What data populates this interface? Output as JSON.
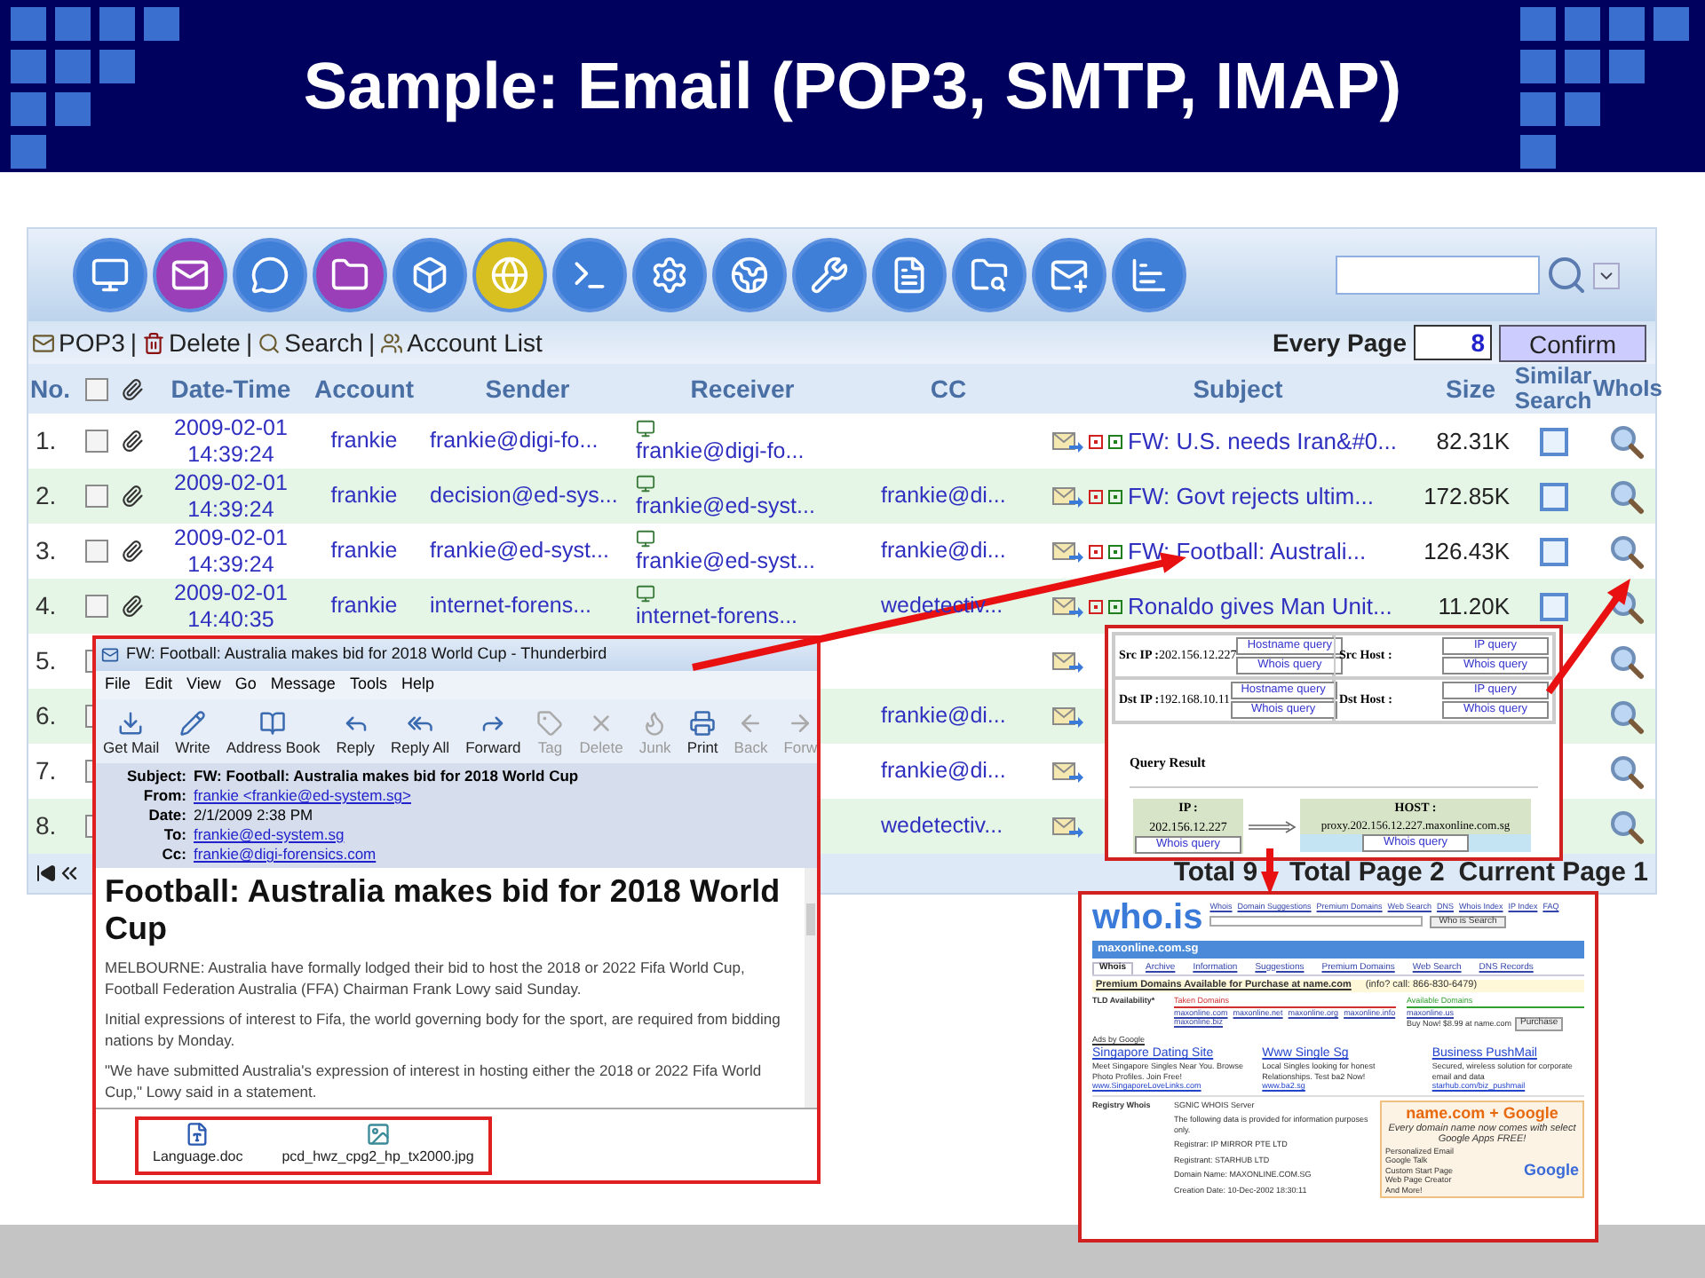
{
  "slide": {
    "title": "Sample: Email (POP3, SMTP, IMAP)"
  },
  "app": {
    "actions": [
      {
        "kind": "link",
        "label": "POP3"
      },
      {
        "kind": "separator",
        "label": "|"
      },
      {
        "kind": "link",
        "label": "Delete"
      },
      {
        "kind": "separator",
        "label": "|"
      },
      {
        "kind": "link",
        "label": "Search"
      },
      {
        "kind": "separator",
        "label": "|"
      },
      {
        "kind": "link",
        "label": "Account List"
      }
    ],
    "every_page": {
      "label": "Every Page",
      "value": "8",
      "button": "Confirm"
    },
    "columns": [
      {
        "kind": "text",
        "label": "No."
      },
      {
        "kind": "checkbox",
        "checked": false
      },
      {
        "kind": "attachment"
      },
      {
        "kind": "text",
        "label": "Date-Time"
      },
      {
        "kind": "text",
        "label": "Account"
      },
      {
        "kind": "text",
        "label": "Sender"
      },
      {
        "kind": "text",
        "label": "Receiver"
      },
      {
        "kind": "text",
        "label": "CC"
      },
      {
        "kind": "text",
        "label": "Subject"
      },
      {
        "kind": "text",
        "label": "Size"
      },
      {
        "kind": "text",
        "label": "Similar Search"
      },
      {
        "kind": "text",
        "label": "WhoIs"
      }
    ],
    "rows": [
      {
        "no": "1.",
        "checked": false,
        "date": "2009-02-01",
        "time": "14:39:24",
        "account": "frankie",
        "sender": "frankie@digi-fo...",
        "receiver": "frankie@digi-fo...",
        "subject": "FW: U.S. needs Iran&#0...",
        "size": "82.31K"
      },
      {
        "no": "2.",
        "checked": false,
        "date": "2009-02-01",
        "time": "14:39:24",
        "account": "frankie",
        "sender": "decision@ed-sys...",
        "receiver": "frankie@ed-syst...",
        "cc": "frankie@di...",
        "subject": "FW: Govt rejects ultim...",
        "size": "172.85K"
      },
      {
        "no": "3.",
        "checked": false,
        "date": "2009-02-01",
        "time": "14:39:24",
        "account": "frankie",
        "sender": "frankie@ed-syst...",
        "receiver": "frankie@ed-syst...",
        "cc": "frankie@di...",
        "subject": "FW: Football: Australi...",
        "size": "126.43K"
      },
      {
        "no": "4.",
        "checked": false,
        "date": "2009-02-01",
        "time": "14:40:35",
        "account": "frankie",
        "sender": "internet-forens...",
        "receiver": "internet-forens...",
        "cc": "wedetectiv...",
        "subject": "Ronaldo gives Man Unit...",
        "size": "11.20K"
      },
      {
        "no": "5.",
        "checked": false
      },
      {
        "no": "6.",
        "checked": false,
        "cc": "frankie@di..."
      },
      {
        "no": "7.",
        "checked": false,
        "cc": "frankie@di..."
      },
      {
        "no": "8.",
        "checked": false,
        "cc": "wedetectiv..."
      }
    ],
    "footer": [
      "Total 9",
      "Total Page 2",
      "Current Page 1"
    ]
  },
  "thunderbird": {
    "title": "FW: Football: Australia makes bid for 2018 World Cup - Thunderbird",
    "menu": [
      "File",
      "Edit",
      "View",
      "Go",
      "Message",
      "Tools",
      "Help"
    ],
    "toolbar": [
      {
        "label": "Get Mail",
        "disabled": false
      },
      {
        "label": "Write",
        "disabled": false
      },
      {
        "label": "Address Book",
        "disabled": false
      },
      {
        "label": "Reply",
        "disabled": false
      },
      {
        "label": "Reply All",
        "disabled": false
      },
      {
        "label": "Forward",
        "disabled": false
      },
      {
        "label": "Tag",
        "disabled": true
      },
      {
        "label": "Delete",
        "disabled": true
      },
      {
        "label": "Junk",
        "disabled": true
      },
      {
        "label": "Print",
        "disabled": false
      },
      {
        "label": "Back",
        "disabled": true
      },
      {
        "label": "Forw",
        "disabled": true
      }
    ],
    "headers": [
      {
        "label": "Subject:",
        "value": "FW: Football: Australia makes bid for 2018 World Cup",
        "kind": "text"
      },
      {
        "label": "From:",
        "value": "frankie <frankie@ed-system.sg>",
        "kind": "link"
      },
      {
        "label": "Date:",
        "value": "2/1/2009 2:38 PM",
        "kind": "text"
      },
      {
        "label": "To:",
        "value": "frankie@ed-system.sg",
        "kind": "link"
      },
      {
        "label": "Cc:",
        "value": "frankie@digi-forensics.com",
        "kind": "link"
      }
    ],
    "heading": "Football: Australia makes bid for 2018 World Cup",
    "paragraphs": [
      "MELBOURNE: Australia have formally lodged their bid to host the 2018 or 2022 Fifa World Cup, Football Federation Australia (FFA) Chairman Frank Lowy said Sunday.",
      "Initial expressions of interest to Fifa, the world governing body for the sport, are required from bidding nations by Monday.",
      "\"We have submitted Australia's expression of interest in hosting either the 2018 or 2022 Fifa World Cup,\" Lowy said in a statement."
    ],
    "attachments": [
      {
        "name": "Language.doc",
        "kind": "doc"
      },
      {
        "name": "pcd_hwz_cpg2_hp_tx2000.jpg",
        "kind": "image"
      }
    ]
  },
  "ip_query": {
    "cells": [
      {
        "label": "Src IP :",
        "value": "202.156.12.227",
        "buttons": [
          "Hostname query",
          "Whois query"
        ]
      },
      {
        "label": "Src Host :",
        "buttons": [
          "IP query",
          "Whois query"
        ]
      },
      {
        "label": "Dst IP :",
        "value": "192.168.10.11",
        "buttons": [
          "Hostname query",
          "Whois query"
        ]
      },
      {
        "label": "Dst Host :",
        "buttons": [
          "IP query",
          "Whois query"
        ]
      }
    ],
    "result_title": "Query Result",
    "ip": {
      "label": "IP :",
      "value": "202.156.12.227",
      "button": "Whois query"
    },
    "host": {
      "label": "HOST :",
      "value": "proxy.202.156.12.227.maxonline.com.sg",
      "button": "Whois query"
    }
  },
  "whois": {
    "logo": "who.is",
    "nav": [
      "Whois",
      "Domain Suggestions",
      "Premium Domains",
      "Web Search",
      "DNS",
      "Whois Index",
      "IP Index",
      "FAQ"
    ],
    "search_button": "Who is Search",
    "domain": "maxonline.com.sg",
    "tabs": [
      {
        "label": "Whois",
        "selected": true
      },
      {
        "label": "Archive",
        "selected": false
      },
      {
        "label": "Information",
        "selected": false
      },
      {
        "label": "Suggestions",
        "selected": false
      },
      {
        "label": "Premium Domains",
        "selected": false
      },
      {
        "label": "Web Search",
        "selected": false
      },
      {
        "label": "DNS Records",
        "selected": false
      }
    ],
    "promo": "Premium Domains Available for Purchase at name.com",
    "promo_info": "(info? call: 866-830-6479)",
    "tld_label": "TLD Availability*",
    "taken_label": "Taken Domains",
    "taken": [
      "maxonline.com",
      "maxonline.net",
      "maxonline.org",
      "maxonline.info",
      "maxonline.biz"
    ],
    "available_label": "Available Domains",
    "available": [
      "maxonline.us"
    ],
    "buy": "Buy Now! $8.99 at name.com",
    "purchase": "Purchase",
    "ads_label": "Ads by Google",
    "ads": [
      {
        "title": "Singapore Dating Site",
        "text": "Meet Singapore Singles Near You. Browse Photo Profiles. Join Free!",
        "url": "www.SingaporeLoveLinks.com"
      },
      {
        "title": "Www Single Sg",
        "text": "Local Singles looking for honest Relationships. Test ba2 Now!",
        "url": "www.ba2.sg"
      },
      {
        "title": "Business PushMail",
        "text": "Secured, wireless solution for corporate email and data",
        "url": "starhub.com/biz_pushmail"
      }
    ],
    "registry_label": "Registry Whois",
    "registry_lines": [
      "SGNIC WHOIS Server",
      "The following data is provided for information purposes only.",
      "Registrar:  IP MIRROR PTE LTD",
      "Registrant:  STARHUB LTD",
      "Domain Name: MAXONLINE.COM.SG",
      "Creation Date: 10-Dec-2002 18:30:11"
    ],
    "banner": {
      "title": "name.com + Google",
      "text": "Every domain name now comes with select Google Apps FREE!",
      "items": [
        "Personalized Email",
        "Google Talk",
        "Custom Start Page",
        "Web Page Creator",
        "And More!"
      ],
      "brand": "Google"
    }
  }
}
